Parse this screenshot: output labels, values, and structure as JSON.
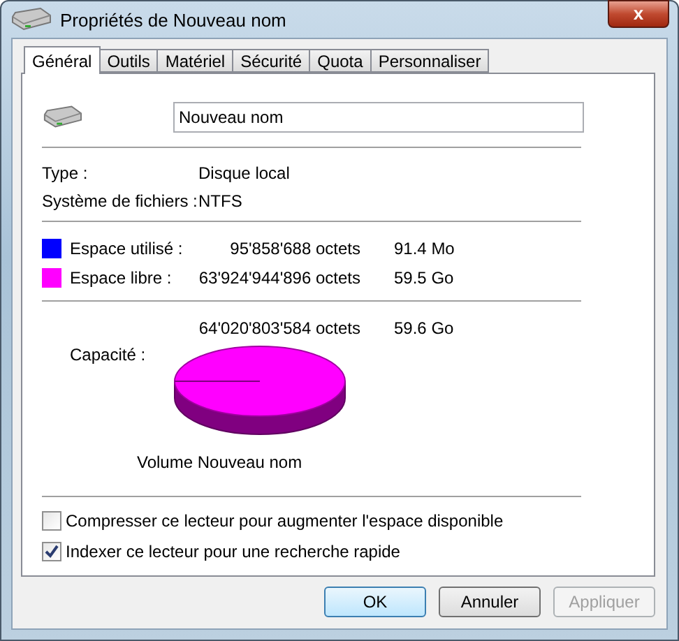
{
  "window": {
    "title": "Propriétés de Nouveau nom",
    "close": "x"
  },
  "tabs": [
    {
      "label": "Général",
      "selected": true
    },
    {
      "label": "Outils",
      "selected": false
    },
    {
      "label": "Matériel",
      "selected": false
    },
    {
      "label": "Sécurité",
      "selected": false
    },
    {
      "label": "Quota",
      "selected": false
    },
    {
      "label": "Personnaliser",
      "selected": false
    }
  ],
  "name_field": {
    "value": "Nouveau nom"
  },
  "info": [
    {
      "label": "Type :",
      "value": "Disque local"
    },
    {
      "label": "Système de fichiers :",
      "value": "NTFS"
    }
  ],
  "space": [
    {
      "label": "Espace utilisé :",
      "bytes": "95'858'688 octets",
      "size": "91.4 Mo",
      "color": "#0000ff"
    },
    {
      "label": "Espace libre :",
      "bytes": "63'924'944'896 octets",
      "size": "59.5 Go",
      "color": "#ff00ff"
    }
  ],
  "capacity": {
    "label": "Capacité :",
    "bytes": "64'020'803'584 octets",
    "size": "59.6 Go"
  },
  "volume_label": "Volume Nouveau nom",
  "options": [
    {
      "label": "Compresser ce lecteur pour augmenter l'espace disponible",
      "checked": false
    },
    {
      "label": "Indexer ce lecteur pour une recherche rapide",
      "checked": true
    }
  ],
  "buttons": [
    {
      "label": "OK",
      "kind": "default",
      "disabled": false
    },
    {
      "label": "Annuler",
      "kind": "normal",
      "disabled": false
    },
    {
      "label": "Appliquer",
      "kind": "normal",
      "disabled": true
    }
  ]
}
